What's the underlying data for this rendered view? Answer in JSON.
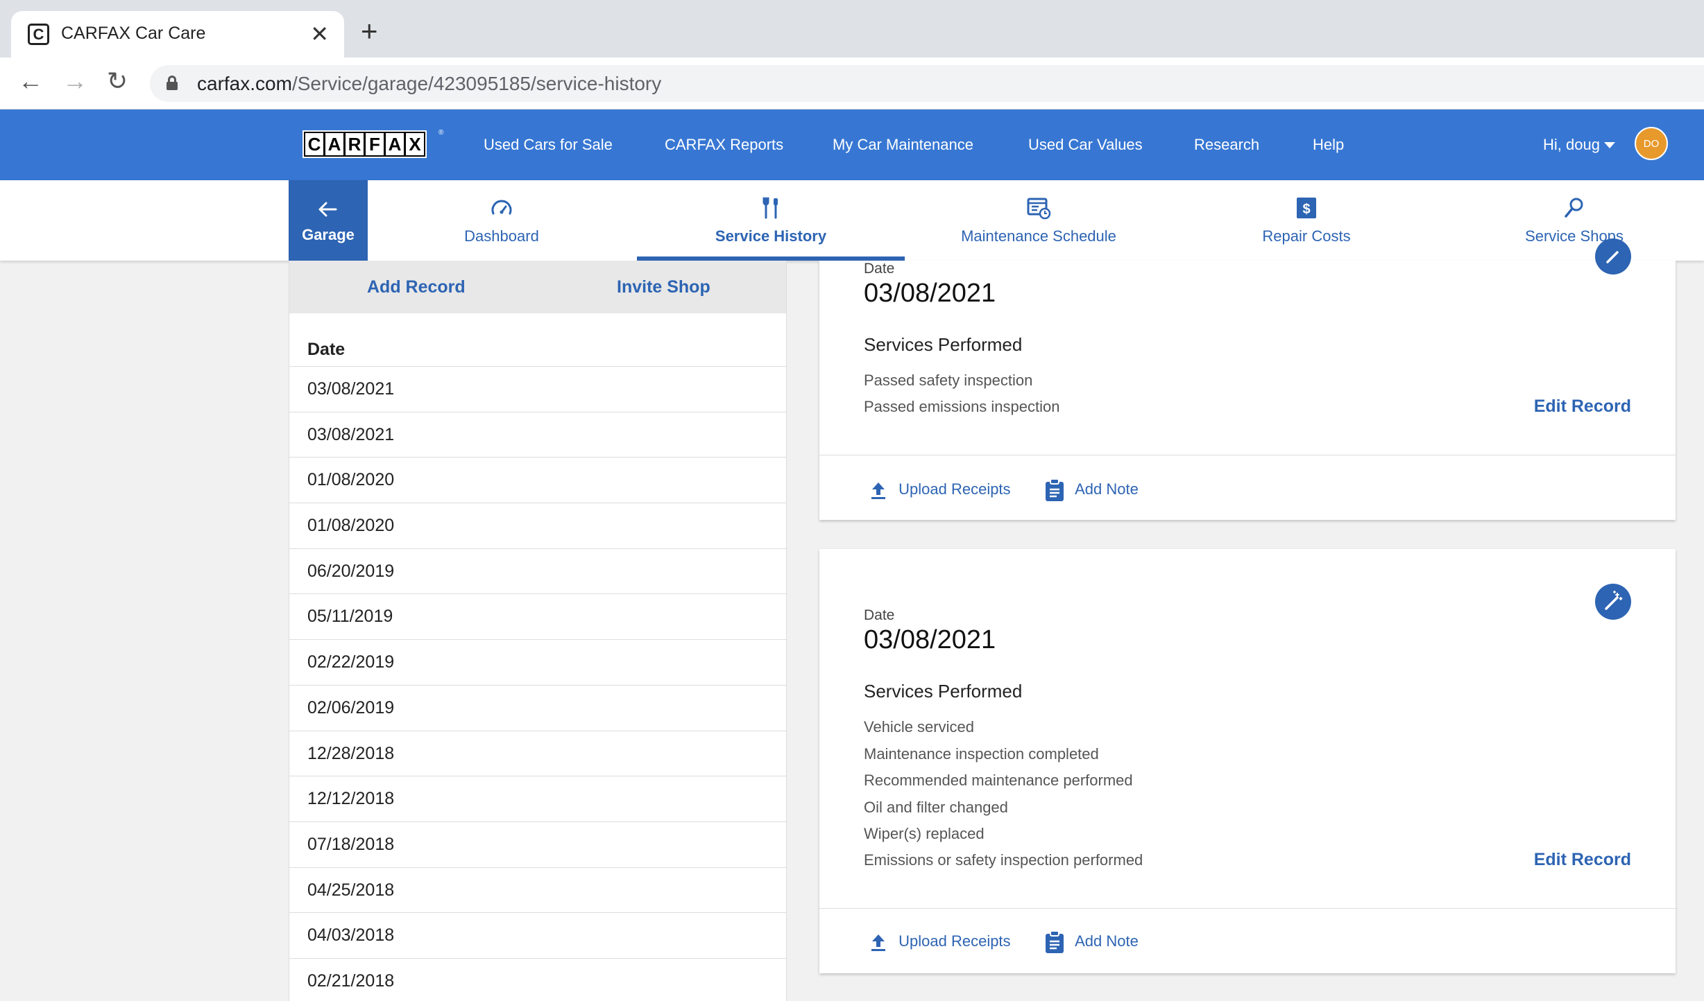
{
  "browser": {
    "tab_title": "CARFAX Car Care",
    "favicon_letter": "C",
    "close_glyph": "✕",
    "newtab_glyph": "+",
    "back_glyph": "←",
    "forward_glyph": "→",
    "reload_glyph": "↻",
    "url_host": "carfax.com",
    "url_path": "/Service/garage/423095185/service-history"
  },
  "header": {
    "logo_letters": [
      "C",
      "A",
      "R",
      "F",
      "A",
      "X"
    ],
    "logo_tm": "®",
    "nav": [
      "Used Cars for Sale",
      "CARFAX Reports",
      "My Car Maintenance",
      "Used Car Values",
      "Research",
      "Help"
    ],
    "greeting": "Hi, doug",
    "avatar_initials": "DO"
  },
  "subnav": {
    "garage_label": "Garage",
    "tabs": [
      {
        "label": "Dashboard",
        "icon": "speedometer-icon"
      },
      {
        "label": "Service History",
        "icon": "wrench-screwdriver-icon"
      },
      {
        "label": "Maintenance Schedule",
        "icon": "calendar-clock-icon"
      },
      {
        "label": "Repair Costs",
        "icon": "dollar-icon"
      },
      {
        "label": "Service Shops",
        "icon": "search-icon"
      }
    ],
    "active_tab": "Service History"
  },
  "left_panel": {
    "add_record": "Add Record",
    "invite_shop": "Invite Shop",
    "date_header": "Date",
    "dates": [
      "03/08/2021",
      "03/08/2021",
      "01/08/2020",
      "01/08/2020",
      "06/20/2019",
      "05/11/2019",
      "02/22/2019",
      "02/06/2019",
      "12/28/2018",
      "12/12/2018",
      "07/18/2018",
      "04/25/2018",
      "04/03/2018",
      "02/21/2018"
    ]
  },
  "cards": [
    {
      "date_label": "Date",
      "date": "03/08/2021",
      "services_title": "Services Performed",
      "services": [
        "Passed safety inspection",
        "Passed emissions inspection"
      ],
      "edit": "Edit Record",
      "upload": "Upload Receipts",
      "note": "Add Note"
    },
    {
      "date_label": "Date",
      "date": "03/08/2021",
      "services_title": "Services Performed",
      "services": [
        "Vehicle serviced",
        "Maintenance inspection completed",
        "Recommended maintenance performed",
        "Oil and filter changed",
        "Wiper(s) replaced",
        "Emissions or safety inspection performed"
      ],
      "edit": "Edit Record",
      "upload": "Upload Receipts",
      "note": "Add Note"
    }
  ],
  "colors": {
    "brand_blue": "#3777d3",
    "link_blue": "#2d64b3",
    "avatar_orange": "#e8992c"
  }
}
